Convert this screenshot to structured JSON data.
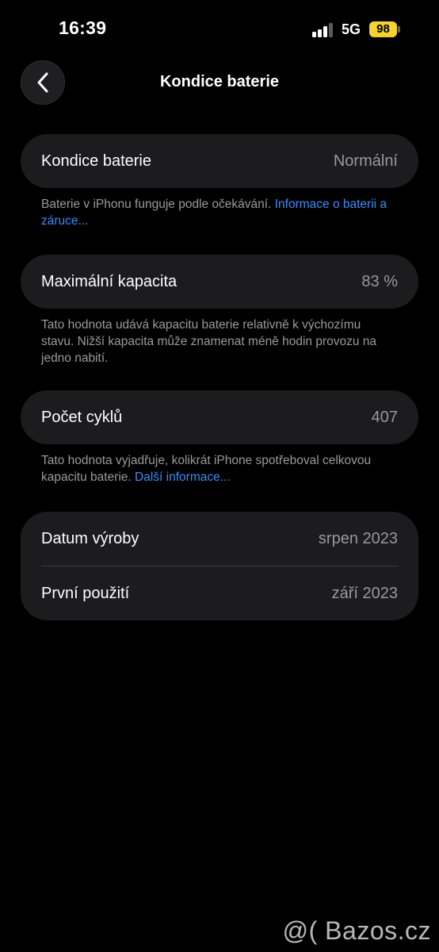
{
  "status_bar": {
    "time": "16:39",
    "network": "5G",
    "battery_level": "98",
    "signal_bars_active": 3,
    "signal_bars_total": 4,
    "battery_color": "#f4d232"
  },
  "nav": {
    "back_icon": "chevron-left-icon",
    "title": "Kondice baterie"
  },
  "sections": {
    "health": {
      "label": "Kondice baterie",
      "value": "Normální",
      "footnote_text": "Baterie v iPhonu funguje podle očekávání. ",
      "footnote_link": "Informace o baterii a záruce..."
    },
    "capacity": {
      "label": "Maximální kapacita",
      "value": "83 %",
      "footnote_text": "Tato hodnota udává kapacitu baterie relativně k výchozímu stavu. Nižší kapacita může znamenat méně hodin provozu na jedno nabití."
    },
    "cycles": {
      "label": "Počet cyklů",
      "value": "407",
      "footnote_text": "Tato hodnota vyjadřuje, kolikrát iPhone spotřeboval celkovou kapacitu baterie. ",
      "footnote_link": "Další informace..."
    },
    "dates": {
      "manufacture_label": "Datum výroby",
      "manufacture_value": "srpen 2023",
      "first_use_label": "První použití",
      "first_use_value": "září 2023"
    }
  },
  "watermark": "@( Bazos.cz",
  "colors": {
    "background": "#000000",
    "card": "#1c1c1e",
    "link": "#3b8cf5",
    "secondary_text": "#98989e"
  }
}
